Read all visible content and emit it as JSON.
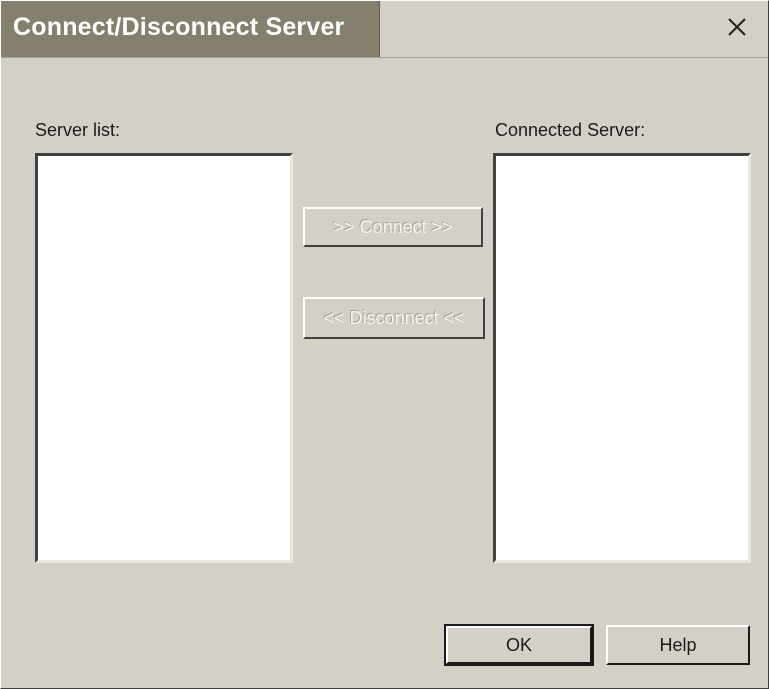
{
  "dialog": {
    "title": "Connect/Disconnect Server",
    "close_icon": "close-icon"
  },
  "server_list": {
    "label": "Server list:",
    "items": []
  },
  "connected_server": {
    "label": "Connected Server:",
    "items": []
  },
  "actions": {
    "connect_label": ">> Connect >>",
    "disconnect_label": "<< Disconnect <<",
    "connect_enabled": false,
    "disconnect_enabled": false
  },
  "footer": {
    "ok_label": "OK",
    "help_label": "Help"
  }
}
